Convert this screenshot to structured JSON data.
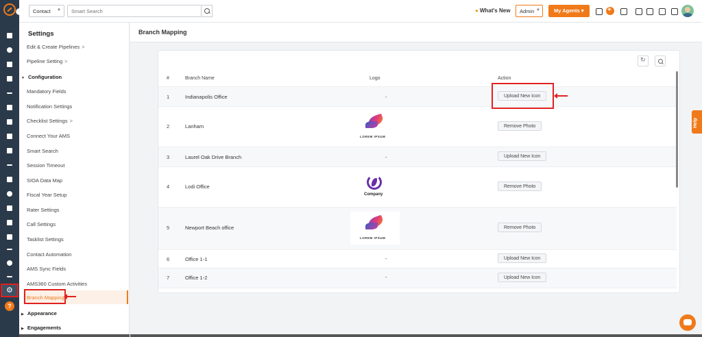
{
  "topbar": {
    "entity_select": "Contact",
    "search_placeholder": "Smart Search",
    "whats_new": "What's New",
    "role_select": "Admin",
    "agents_button": "My Agents"
  },
  "sidebar": {
    "title": "Settings",
    "items_top": [
      {
        "label": "Edit & Create Pipelines",
        "arrow": ">"
      },
      {
        "label": "Pipeline Setting",
        "arrow": ">"
      }
    ],
    "configuration_group": "Configuration",
    "config_items": [
      "Mandatory Fields",
      "Notification Settings",
      "Checklist Settings",
      "Connect Your AMS",
      "Smart Search",
      "Session Timeout",
      "SIOA Data Map",
      "Fiscal Year Setup",
      "Rater Settings",
      "Call Settings",
      "Tasklist Settings",
      "Contact Automation",
      "AMS Sync Fields",
      "AMS360 Custom Activities"
    ],
    "checklist_arrow": ">",
    "active_item": "Branch Mapping",
    "appearance_group": "Appearance",
    "engagements_group": "Engagements"
  },
  "main": {
    "page_title": "Branch Mapping",
    "columns": {
      "num": "#",
      "branch": "Branch Name",
      "logo": "Logo",
      "action": "Action"
    },
    "rows": [
      {
        "num": "1",
        "name": "Indianapolis Office",
        "logo": "-",
        "action": "Upload New Icon"
      },
      {
        "num": "2",
        "name": "Lanham",
        "logo_caption": "LOREM IPSUM",
        "action": "Remove Photo"
      },
      {
        "num": "3",
        "name": "Laurel Oak Drive Branch",
        "logo": "-",
        "action": "Upload New Icon"
      },
      {
        "num": "4",
        "name": "Lodi Office",
        "logo_caption": "Company",
        "action": "Remove Photo"
      },
      {
        "num": "5",
        "name": "Newport Beach office",
        "logo_caption": "LOREM IPSUM",
        "action": "Remove Photo"
      },
      {
        "num": "6",
        "name": "Office 1-1",
        "logo": "-",
        "action": "Upload New Icon"
      },
      {
        "num": "7",
        "name": "Office 1-2",
        "logo": "-",
        "action": "Upload New Icon"
      }
    ]
  },
  "help_tab": "Help",
  "colors": {
    "accent": "#f07a1a",
    "annotation": "#e02020",
    "rail": "#2b3a4a"
  }
}
